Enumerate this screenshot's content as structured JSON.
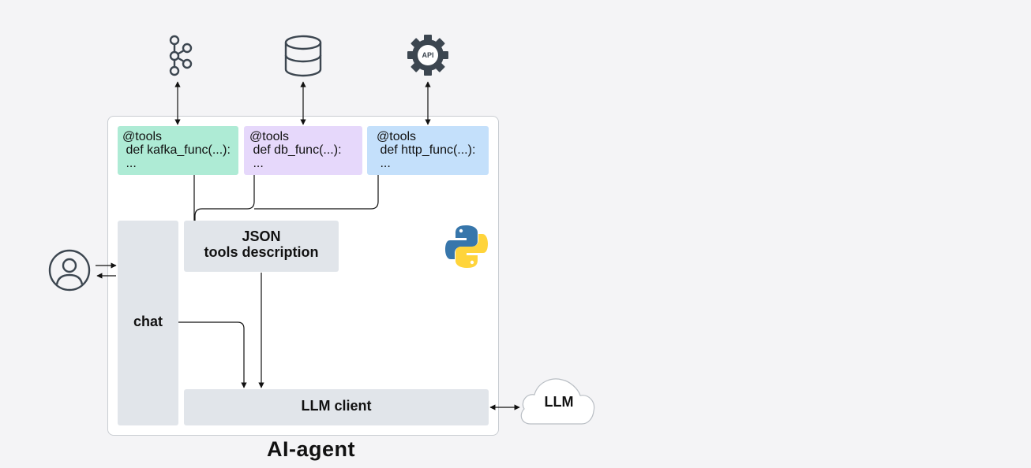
{
  "tools": [
    {
      "decorator": "@tools",
      "def_line": " def kafka_func(...):",
      "body": " ..."
    },
    {
      "decorator": "@tools",
      "def_line": " def db_func(...):",
      "body": " ..."
    },
    {
      "decorator": "@tools",
      "def_line": " def http_func(...):",
      "body": " ..."
    }
  ],
  "icons": {
    "kafka": "kafka-icon",
    "database": "database-icon",
    "api": "api-gear-icon",
    "api_text": "API",
    "user": "user-icon",
    "python": "python-logo-icon",
    "llm": "cloud-icon"
  },
  "blocks": {
    "chat": "chat",
    "json_line1": "JSON",
    "json_line2": "tools description",
    "llm_client": "LLM client",
    "llm": "LLM"
  },
  "title": "AI-agent",
  "colors": {
    "kafka_tool": "#aeebd5",
    "db_tool": "#e6d8fb",
    "http_tool": "#c4e0fb",
    "block": "#e1e5ea",
    "icon": "#3c4650"
  }
}
